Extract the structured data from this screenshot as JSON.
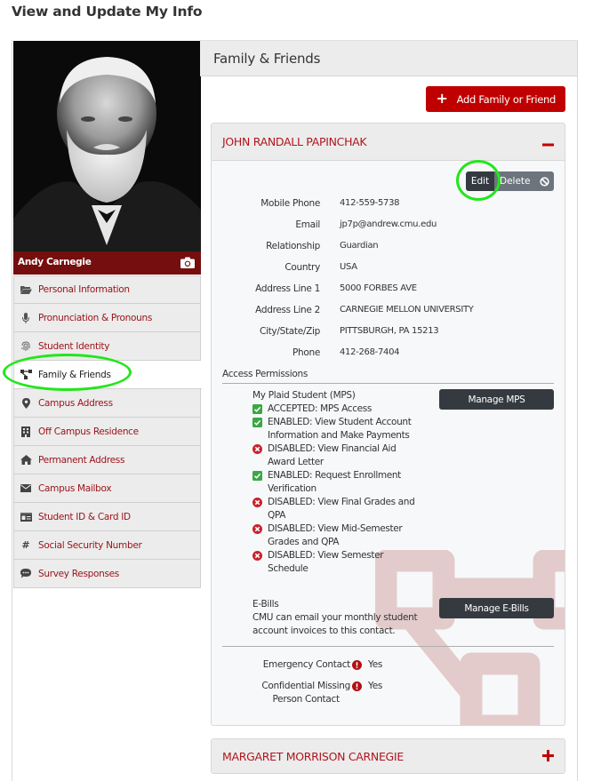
{
  "page": {
    "title": "View and Update My Info"
  },
  "profile": {
    "name": "Andy Carnegie",
    "photo_icon": "camera-icon"
  },
  "sidebar": {
    "items": [
      {
        "label": "Personal Information",
        "icon": "folder-open-icon",
        "active": false
      },
      {
        "label": "Pronunciation & Pronouns",
        "icon": "microphone-icon",
        "active": false
      },
      {
        "label": "Student Identity",
        "icon": "fingerprint-icon",
        "active": false
      },
      {
        "label": "Family & Friends",
        "icon": "sitemap-icon",
        "active": true
      },
      {
        "label": "Campus Address",
        "icon": "map-marker-icon",
        "active": false
      },
      {
        "label": "Off Campus Residence",
        "icon": "building-icon",
        "active": false
      },
      {
        "label": "Permanent Address",
        "icon": "home-icon",
        "active": false
      },
      {
        "label": "Campus Mailbox",
        "icon": "envelope-icon",
        "active": false
      },
      {
        "label": "Student ID & Card ID",
        "icon": "id-card-icon",
        "active": false
      },
      {
        "label": "Social Security Number",
        "icon": "hashtag-icon",
        "active": false
      },
      {
        "label": "Survey Responses",
        "icon": "comment-icon",
        "active": false
      }
    ]
  },
  "main": {
    "section_title": "Family & Friends",
    "add_button": "Add Family or Friend",
    "contacts": [
      {
        "name": "JOHN RANDALL PAPINCHAK",
        "expanded": true,
        "toggle": "−",
        "edit_label": "Edit",
        "delete_label": "Delete",
        "fields": [
          {
            "label": "Mobile Phone",
            "value": "412-559-5738"
          },
          {
            "label": "Email",
            "value": "jp7p@andrew.cmu.edu"
          },
          {
            "label": "Relationship",
            "value": "Guardian"
          },
          {
            "label": "Country",
            "value": "USA"
          },
          {
            "label": "Address Line 1",
            "value": "5000 FORBES AVE"
          },
          {
            "label": "Address Line 2",
            "value": "CARNEGIE MELLON UNIVERSITY"
          },
          {
            "label": "City/State/Zip",
            "value": "PITTSBURGH, PA 15213"
          },
          {
            "label": "Phone",
            "value": "412-268-7404"
          }
        ],
        "access_permissions_title": "Access Permissions",
        "mps": {
          "title": "My Plaid Student (MPS)",
          "button": "Manage MPS",
          "permissions": [
            {
              "status": "enabled",
              "text": "ACCEPTED: MPS Access"
            },
            {
              "status": "enabled",
              "text": "ENABLED: View Student Account Information and Make Payments"
            },
            {
              "status": "disabled",
              "text": "DISABLED: View Financial Aid Award Letter"
            },
            {
              "status": "enabled",
              "text": "ENABLED: Request Enrollment Verification"
            },
            {
              "status": "disabled",
              "text": "DISABLED: View Final Grades and QPA"
            },
            {
              "status": "disabled",
              "text": "DISABLED: View Mid-Semester Grades and QPA"
            },
            {
              "status": "disabled",
              "text": "DISABLED: View Semester Schedule"
            }
          ]
        },
        "ebills": {
          "title": "E-Bills",
          "description": "CMU can email your monthly student account invoices to this contact.",
          "button": "Manage E-Bills"
        },
        "flags": [
          {
            "label": "Emergency Contact",
            "value": "Yes"
          },
          {
            "label": "Confidential Missing Person Contact",
            "label_line1": "Confidential Missing",
            "label_line2": "Person Contact",
            "value": "Yes"
          }
        ]
      },
      {
        "name": "MARGARET MORRISON CARNEGIE",
        "expanded": false,
        "toggle": "+"
      }
    ]
  },
  "colors": {
    "brand_red": "#c00000",
    "link_red": "#9b1118",
    "dark_button": "#343a40",
    "secondary_button": "#6c757d",
    "enabled_green": "#3aa845",
    "disabled_red": "#c8232c",
    "highlight": "#22e61a"
  }
}
